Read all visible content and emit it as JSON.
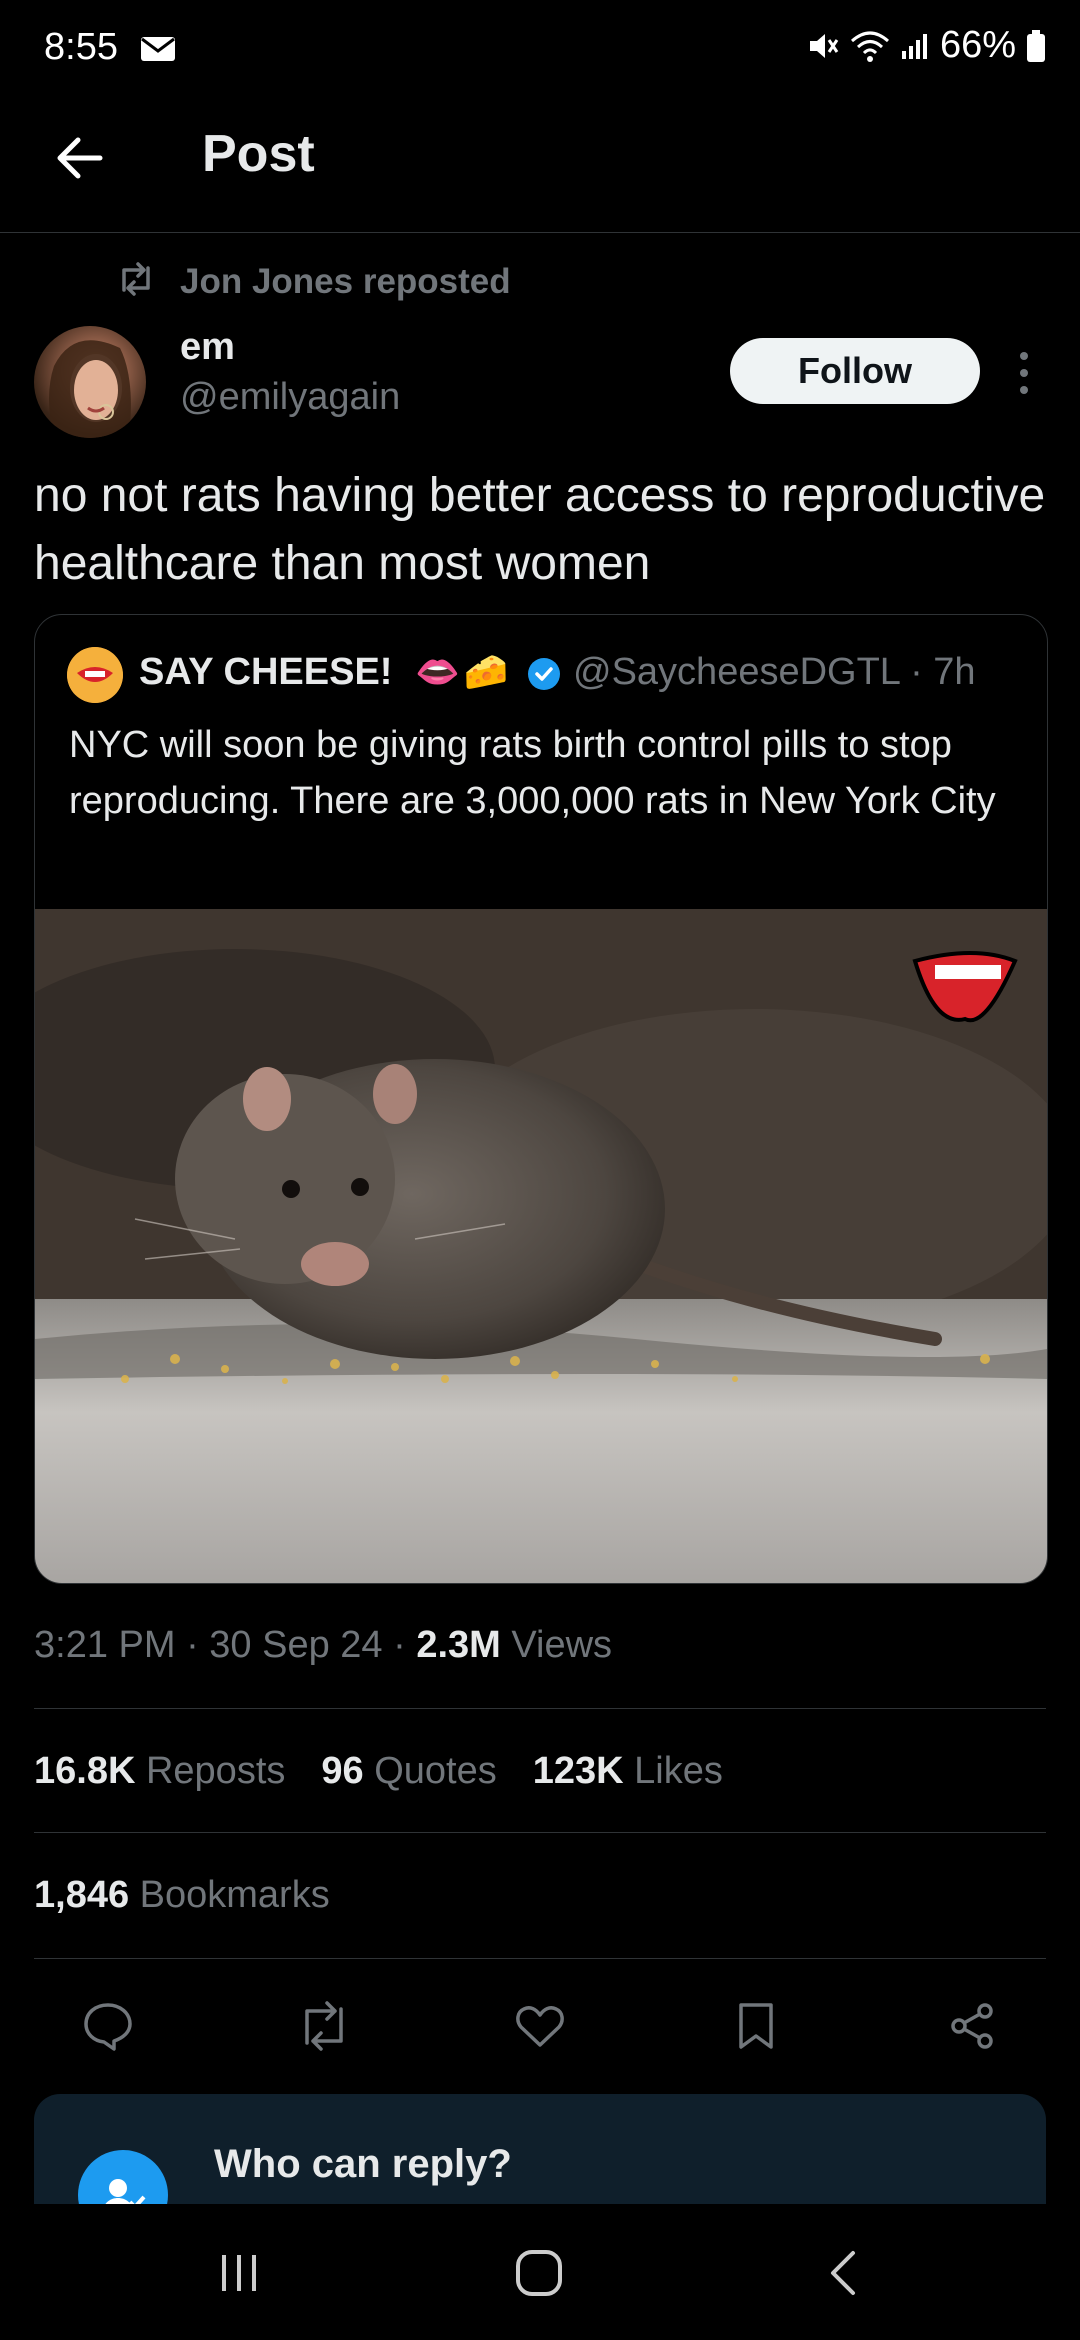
{
  "status_bar": {
    "time": "8:55",
    "battery": "66%"
  },
  "header": {
    "title": "Post"
  },
  "repost": {
    "label": "Jon Jones reposted"
  },
  "author": {
    "name": "em",
    "handle": "@emilyagain",
    "follow_label": "Follow"
  },
  "post": {
    "text": "no not rats having better access to reproductive healthcare than most women"
  },
  "quote": {
    "name": "SAY CHEESE!",
    "emojis": [
      "👄",
      "🧀"
    ],
    "handle": "@SaycheeseDGTL · 7h",
    "text": "NYC will soon be giving rats birth control pills to stop reproducing. There are 3,000,000 rats in New York City",
    "image_logo": "SAY CHEESE"
  },
  "meta": {
    "time": "3:21 PM · 30 Sep 24 · ",
    "views_count": "2.3M",
    "views_label": " Views"
  },
  "stats": {
    "reposts_count": "16.8K",
    "reposts_label": "Reposts",
    "quotes_count": "96",
    "quotes_label": "Quotes",
    "likes_count": "123K",
    "likes_label": "Likes",
    "bookmarks_count": "1,846",
    "bookmarks_label": "Bookmarks"
  },
  "actions": [
    "reply-icon",
    "repost-icon",
    "like-icon",
    "bookmark-icon",
    "share-icon"
  ],
  "reply_settings": {
    "title": "Who can reply?"
  },
  "colors": {
    "accent": "#1d9bf0",
    "background": "#000000",
    "secondary_text": "#71767b"
  }
}
